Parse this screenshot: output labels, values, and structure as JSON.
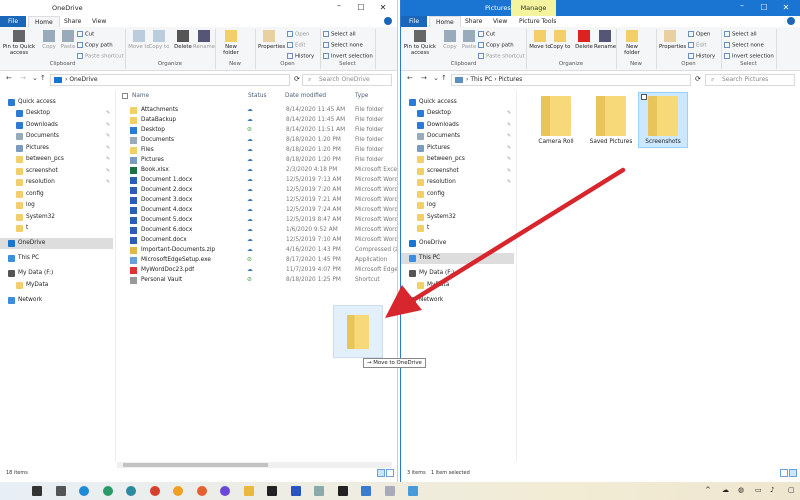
{
  "colors": {
    "accent": "#1a74d2",
    "manage_tab": "#f4f49e",
    "arrow": "#d8262e",
    "selection": "#cce8ff",
    "folder": "#f7d97a"
  },
  "left_window": {
    "title": "OneDrive",
    "tabs": [
      "File",
      "Home",
      "Share",
      "View"
    ],
    "ribbon": {
      "pin": "Pin to Quick access",
      "copy": "Copy",
      "paste": "Paste",
      "cut": "Cut",
      "copy_path": "Copy path",
      "paste_shortcut": "Paste shortcut",
      "move_to": "Move to",
      "copy_to": "Copy to",
      "delete": "Delete",
      "rename": "Rename",
      "new_folder": "New folder",
      "properties": "Properties",
      "open": "Open",
      "edit": "Edit",
      "history": "History",
      "select_all": "Select all",
      "select_none": "Select none",
      "invert_selection": "Invert selection",
      "groups": [
        "Clipboard",
        "Organize",
        "New",
        "Open",
        "Select"
      ]
    },
    "address": {
      "path": [
        "OneDrive"
      ],
      "search_placeholder": "Search OneDrive"
    },
    "nav": [
      {
        "label": "Quick access",
        "icon": "star-icon"
      },
      {
        "label": "Desktop",
        "icon": "desktop-icon",
        "pinned": true
      },
      {
        "label": "Downloads",
        "icon": "download-icon",
        "pinned": true
      },
      {
        "label": "Documents",
        "icon": "documents-icon",
        "pinned": true
      },
      {
        "label": "Pictures",
        "icon": "pictures-icon",
        "pinned": true
      },
      {
        "label": "between_pcs",
        "icon": "folder-icon",
        "pinned": true
      },
      {
        "label": "screenshot",
        "icon": "folder-icon",
        "pinned": true
      },
      {
        "label": "resolution",
        "icon": "folder-icon",
        "pinned": true
      },
      {
        "label": "config",
        "icon": "folder-icon"
      },
      {
        "label": "log",
        "icon": "folder-icon"
      },
      {
        "label": "System32",
        "icon": "folder-icon"
      },
      {
        "label": "t",
        "icon": "folder-icon"
      },
      {
        "label": "OneDrive",
        "icon": "cloud-icon",
        "selected": true
      },
      {
        "label": "This PC",
        "icon": "computer-icon"
      },
      {
        "label": "My Data (F:)",
        "icon": "drive-icon"
      },
      {
        "label": "MyData",
        "icon": "folder-icon"
      },
      {
        "label": "Network",
        "icon": "network-icon"
      }
    ],
    "columns": [
      "Name",
      "Status",
      "Date modified",
      "Type"
    ],
    "files": [
      {
        "name": "Attachments",
        "status": "cloud",
        "date": "8/14/2020 11:45 AM",
        "type": "File folder",
        "icon": "folder-icon"
      },
      {
        "name": "DataBackup",
        "status": "cloud",
        "date": "8/14/2020 11:45 AM",
        "type": "File folder",
        "icon": "folder-icon"
      },
      {
        "name": "Desktop",
        "status": "synced",
        "date": "8/14/2020 11:51 AM",
        "type": "File folder",
        "icon": "desktop-icon"
      },
      {
        "name": "Documents",
        "status": "cloud",
        "date": "8/18/2020 1:20 PM",
        "type": "File folder",
        "icon": "documents-icon"
      },
      {
        "name": "Files",
        "status": "cloud",
        "date": "8/18/2020 1:20 PM",
        "type": "File folder",
        "icon": "folder-icon"
      },
      {
        "name": "Pictures",
        "status": "cloud",
        "date": "8/18/2020 1:20 PM",
        "type": "File folder",
        "icon": "pictures-icon"
      },
      {
        "name": "Book.xlsx",
        "status": "cloud",
        "date": "2/3/2020 4:18 PM",
        "type": "Microsoft Excel W",
        "icon": "excel-icon"
      },
      {
        "name": "Document 1.docx",
        "status": "cloud",
        "date": "12/5/2019 7:13 AM",
        "type": "Microsoft Word D",
        "icon": "word-icon"
      },
      {
        "name": "Document 2.docx",
        "status": "cloud",
        "date": "12/5/2019 7:20 AM",
        "type": "Microsoft Word D",
        "icon": "word-icon"
      },
      {
        "name": "Document 3.docx",
        "status": "cloud",
        "date": "12/5/2019 7:21 AM",
        "type": "Microsoft Word D",
        "icon": "word-icon"
      },
      {
        "name": "Document 4.docx",
        "status": "cloud",
        "date": "12/5/2019 7:24 AM",
        "type": "Microsoft Word D",
        "icon": "word-icon"
      },
      {
        "name": "Document 5.docx",
        "status": "cloud",
        "date": "12/5/2019 8:47 AM",
        "type": "Microsoft Word D",
        "icon": "word-icon"
      },
      {
        "name": "Document 6.docx",
        "status": "cloud",
        "date": "1/6/2020 9:52 AM",
        "type": "Microsoft Word D",
        "icon": "word-icon"
      },
      {
        "name": "Document.docx",
        "status": "cloud",
        "date": "12/5/2019 7:10 AM",
        "type": "Microsoft Word D",
        "icon": "word-icon"
      },
      {
        "name": "Important-Documents.zip",
        "status": "cloud",
        "date": "4/16/2020 1:43 PM",
        "type": "Compressed (zipp",
        "icon": "zip-icon"
      },
      {
        "name": "MicrosoftEdgeSetup.exe",
        "status": "synced",
        "date": "8/17/2020 1:45 PM",
        "type": "Application",
        "icon": "exe-icon"
      },
      {
        "name": "MyWordDoc23.pdf",
        "status": "cloud",
        "date": "11/7/2019 4:07 PM",
        "type": "Microsoft Edge P",
        "icon": "pdf-icon"
      },
      {
        "name": "Personal Vault",
        "status": "synced",
        "date": "8/18/2020 1:25 PM",
        "type": "Shortcut",
        "icon": "vault-icon"
      }
    ],
    "status": "18 items"
  },
  "right_window": {
    "title": "Pictures",
    "context_tab": "Manage",
    "tabs": [
      "File",
      "Home",
      "Share",
      "View",
      "Picture Tools"
    ],
    "address": {
      "path": [
        "This PC",
        "Pictures"
      ],
      "search_placeholder": "Search Pictures"
    },
    "folders": [
      {
        "name": "Camera Roll"
      },
      {
        "name": "Saved Pictures"
      },
      {
        "name": "Screenshots",
        "selected": true
      }
    ],
    "selected_nav": "This PC",
    "status_items": "3 items",
    "status_selected": "1 item selected"
  },
  "drag": {
    "tooltip": "Move to OneDrive"
  },
  "taskbar": {
    "icons": [
      "start-icon",
      "settings-icon",
      "edge-icon",
      "edge-beta-icon",
      "edge-dev-icon",
      "chrome-icon",
      "chrome-canary-icon",
      "firefox-icon",
      "firefox-nightly-icon",
      "file-explorer-icon",
      "store-icon",
      "powershell-icon",
      "notepad-icon",
      "terminal-icon",
      "photos-icon",
      "magnifier-icon",
      "virtualbox-icon"
    ]
  }
}
